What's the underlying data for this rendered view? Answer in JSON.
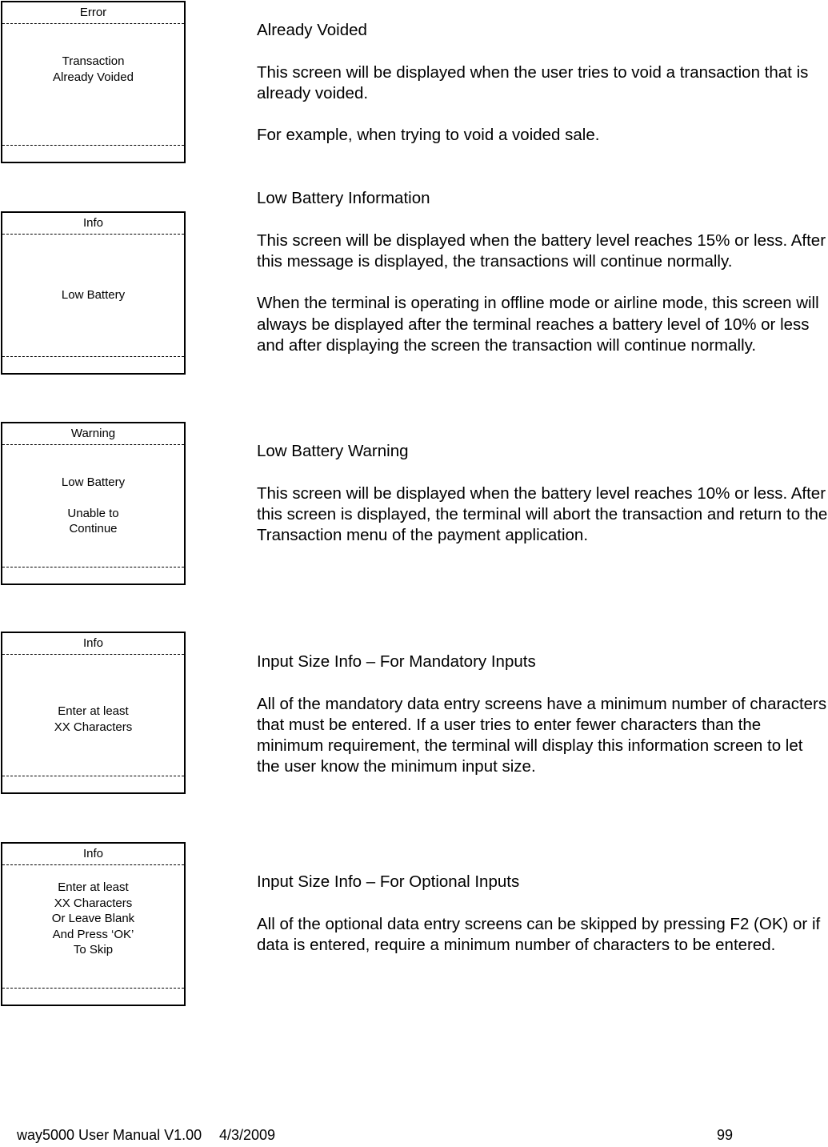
{
  "screens": [
    {
      "header": "Error",
      "lines": [
        "Transaction",
        "Already Voided"
      ]
    },
    {
      "header": "Info",
      "lines": [
        "Low Battery"
      ]
    },
    {
      "header": "Warning",
      "lines": [
        "Low Battery",
        "",
        "Unable to",
        "Continue"
      ]
    },
    {
      "header": "Info",
      "lines": [
        "Enter at least",
        "XX Characters"
      ]
    },
    {
      "header": "Info",
      "lines": [
        "Enter at least",
        "XX Characters",
        "Or Leave Blank",
        "And Press ‘OK’",
        "To Skip"
      ]
    }
  ],
  "sections": [
    {
      "title": "Already Voided",
      "paragraphs": [
        "This screen will be displayed when the user tries to void a transaction that is already voided.",
        "For example, when trying to void a voided sale."
      ]
    },
    {
      "title": "Low Battery Information",
      "paragraphs": [
        "This screen will be displayed when the battery level reaches 15% or less. After this message is displayed, the transactions will continue normally.",
        "When the terminal is operating in offline mode or airline mode, this screen will always be displayed after the terminal reaches a battery level of 10% or less and after displaying the screen the transaction will continue normally."
      ]
    },
    {
      "title": "Low Battery Warning",
      "paragraphs": [
        "This screen will be displayed when the battery level reaches 10% or less. After this screen is displayed, the terminal will abort the transaction and return to the Transaction menu of the payment application."
      ]
    },
    {
      "title": "Input Size Info – For Mandatory Inputs",
      "paragraphs": [
        "All of the mandatory data entry screens have a minimum number of characters that must be entered. If a user tries to enter fewer characters than the minimum requirement, the terminal will display this information screen to let the user know the minimum input size."
      ]
    },
    {
      "title": "Input Size Info – For Optional Inputs",
      "paragraphs": [
        "All of the optional data entry screens can be skipped by pressing F2 (OK) or if data is entered, require a minimum number of characters to be entered."
      ]
    }
  ],
  "footer": {
    "manual": "way5000 User Manual V1.00",
    "date": "4/3/2009",
    "page": "99"
  }
}
